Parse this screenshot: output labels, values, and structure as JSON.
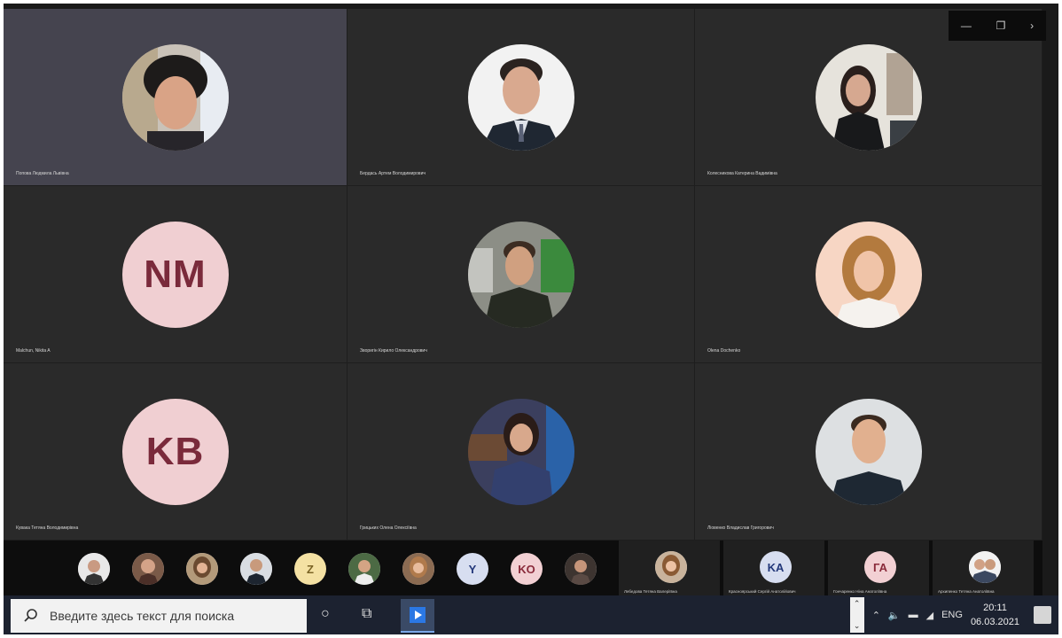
{
  "window": {
    "minimize": "—",
    "restore": "❐",
    "more": "›"
  },
  "participants": [
    {
      "name": "Попова Людмила Львівна",
      "type": "photo",
      "photo": "older-woman"
    },
    {
      "name": "Бердась Артем Володимирович",
      "type": "photo",
      "photo": "man-suit"
    },
    {
      "name": "Колесникова Катерина Вадимівна",
      "type": "photo",
      "photo": "woman-dark"
    },
    {
      "name": "Malchun, Nikita A",
      "type": "initials",
      "initials": "NM"
    },
    {
      "name": "Зворигін Кирило Олександрович",
      "type": "photo",
      "photo": "young-man"
    },
    {
      "name": "Olena Dochenko",
      "type": "photo",
      "photo": "blonde-woman"
    },
    {
      "name": "Кувака Тетяна Володимирівна",
      "type": "initials",
      "initials": "KB"
    },
    {
      "name": "Грицьких Олена Олексіївна",
      "type": "photo",
      "photo": "girl-cafe"
    },
    {
      "name": "Ліовенко Владислав Григорович",
      "type": "photo",
      "photo": "young-man-shirt"
    }
  ],
  "strip": {
    "thumbs": [
      {
        "type": "photo"
      },
      {
        "type": "photo"
      },
      {
        "type": "photo"
      },
      {
        "type": "photo"
      },
      {
        "type": "initials",
        "initials": "Z",
        "color": "yellow"
      },
      {
        "type": "photo"
      },
      {
        "type": "photo"
      },
      {
        "type": "initials",
        "initials": "Y",
        "color": "blue"
      },
      {
        "type": "initials",
        "initials": "KO",
        "color": "pink"
      },
      {
        "type": "photo"
      }
    ],
    "big": [
      {
        "name": "Лебедова Тетяна Валеріївна",
        "type": "photo"
      },
      {
        "name": "Красноярський Сергій Анатолійович",
        "type": "initials",
        "initials": "KA",
        "color": "blue"
      },
      {
        "name": "Гончаренко Ніна Анатоліївна",
        "type": "initials",
        "initials": "ГА",
        "color": "pink"
      },
      {
        "name": "Архипенко Тетяна Анатоліївна",
        "type": "photo"
      }
    ]
  },
  "taskbar": {
    "search_placeholder": "Введите здесь текст для поиска",
    "language": "ENG",
    "time": "20:11",
    "date": "06.03.2021"
  }
}
